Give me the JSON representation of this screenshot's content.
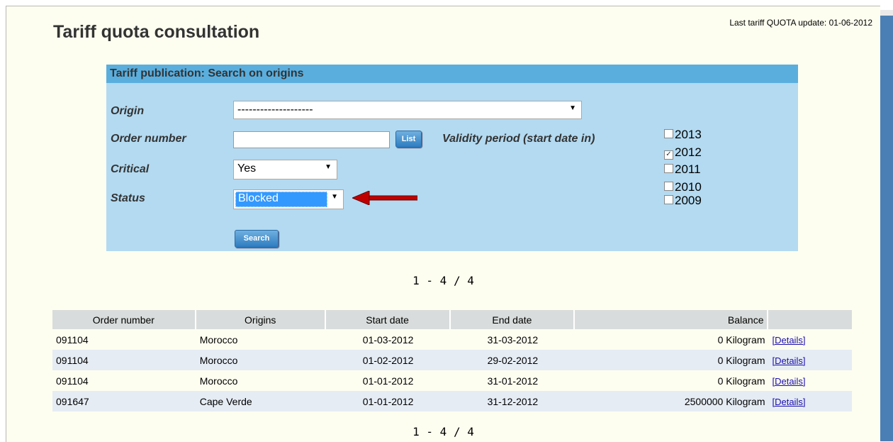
{
  "header": {
    "last_update": "Last tariff QUOTA update: 01-06-2012",
    "title": "Tariff quota consultation"
  },
  "search": {
    "panel_title": "Tariff publication: Search on origins",
    "origin_label": "Origin",
    "origin_value": "--------------------",
    "order_number_label": "Order number",
    "order_number_value": "",
    "list_button": "List",
    "validity_label": "Validity period (start date in)",
    "critical_label": "Critical",
    "critical_value": "Yes",
    "status_label": "Status",
    "status_value": "Blocked",
    "search_button": "Search",
    "years": [
      {
        "year": "2013",
        "checked": false
      },
      {
        "year": "2012",
        "checked": true
      },
      {
        "year": "2011",
        "checked": false
      },
      {
        "year": "2010",
        "checked": false
      },
      {
        "year": "2009",
        "checked": false
      }
    ]
  },
  "pager": {
    "top": "1 - 4 / 4",
    "bottom": "1 - 4 / 4"
  },
  "table": {
    "headers": [
      "Order number",
      "Origins",
      "Start date",
      "End date",
      "Balance",
      ""
    ],
    "rows": [
      {
        "order": "091104",
        "origin": "Morocco",
        "start": "01-03-2012",
        "end": "31-03-2012",
        "balance": "0 Kilogram",
        "link": "[Details]"
      },
      {
        "order": "091104",
        "origin": "Morocco",
        "start": "01-02-2012",
        "end": "29-02-2012",
        "balance": "0 Kilogram",
        "link": "[Details]"
      },
      {
        "order": "091104",
        "origin": "Morocco",
        "start": "01-01-2012",
        "end": "31-01-2012",
        "balance": "0 Kilogram",
        "link": "[Details]"
      },
      {
        "order": "091647",
        "origin": "Cape Verde",
        "start": "01-01-2012",
        "end": "31-12-2012",
        "balance": "2500000 Kilogram",
        "link": "[Details]"
      }
    ]
  },
  "colors": {
    "panel_bg": "#b3daf1",
    "panel_header": "#5aaede",
    "page_bg": "#fefef0",
    "arrow": "#c00000"
  }
}
